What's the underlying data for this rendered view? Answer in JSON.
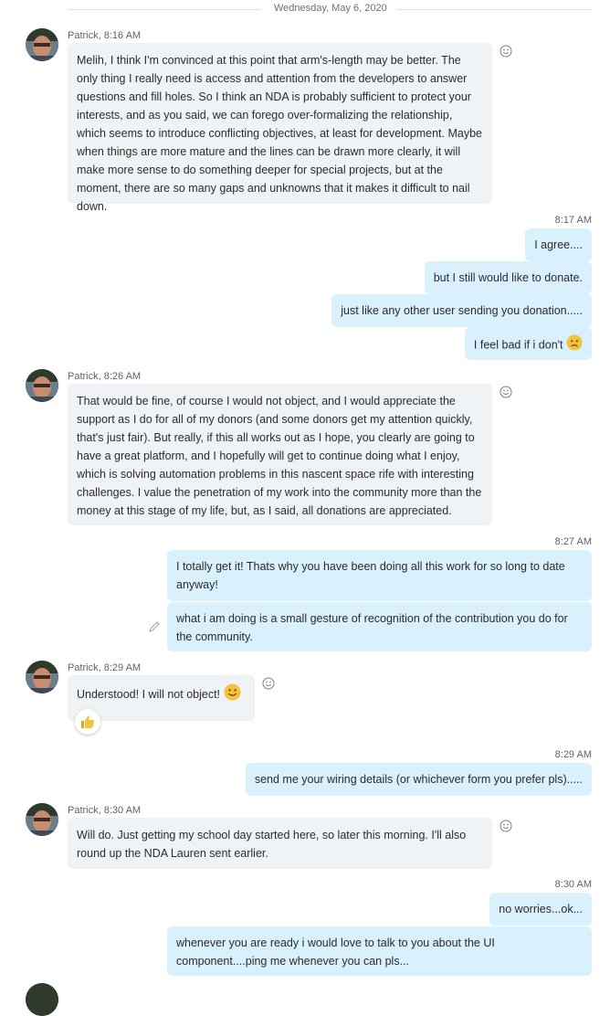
{
  "date_divider": "Wednesday, May 6, 2020",
  "messages": {
    "m1": {
      "sender": "Patrick, 8:16 AM",
      "text": "Melih, I think I'm convinced at this point that arm's-length may be better. The only thing I really need is access and attention from the developers to answer questions and fill holes. So I think an NDA is probably sufficient to protect your interests, and as you said, we can forego over-formalizing the relationship, which seems to introduce conflicting objectives, at least for development. Maybe when things are more mature and the lines can be drawn more clearly, it will make more sense to do something deeper for special projects, but at the moment, there are so many gaps and unknowns that it makes it difficult to nail down."
    },
    "t1": "8:17 AM",
    "o1": "I agree....",
    "o2": "but I still would like to donate.",
    "o3": "just like any other user sending you donation.....",
    "o4": "I feel bad if i don't",
    "m2": {
      "sender": "Patrick, 8:26 AM",
      "text": "That would be fine, of course I would not object, and I would appreciate the support as I do for all of my donors (and some donors get my attention quickly, that's just fair). But really, if this all works out as I hope, you clearly are going to have a great platform, and I hopefully will get to continue doing what I enjoy, which is solving automation problems in this nascent space rife with interesting challenges. I value the penetration of my work into the community more than the money at this stage of my life, but, as I said, all donations are appreciated."
    },
    "t2": "8:27 AM",
    "o5": "I totally get it! Thats why you have been doing all this work for so long to date anyway!",
    "o6": "what i am doing is a small gesture of recognition of the contribution you do for the community.",
    "m3": {
      "sender": "Patrick, 8:29 AM",
      "text": "Understood! I will not object!"
    },
    "t3": "8:29 AM",
    "o7": "send me your wiring details (or whichever form you prefer pls).....",
    "m4": {
      "sender": "Patrick, 8:30 AM",
      "text": "Will do. Just getting my school day started here, so later this morning. I'll also round up the NDA Lauren sent earlier."
    },
    "t4": "8:30 AM",
    "o8": "no worries...ok...",
    "o9": "whenever you are ready i would love to talk to you about the UI component....ping me whenever you can pls..."
  },
  "icons": {
    "react": "smiley-outline-icon",
    "sad": "sad-face-emoji",
    "smile": "smile-emoji",
    "thumbs": "thumbs-up-reaction",
    "edit": "pencil-edit-icon"
  },
  "colors": {
    "incoming_bubble": "#f0f3f6",
    "outgoing_bubble": "#d8f1fc",
    "emoji_yellow": "#f5c33b"
  }
}
